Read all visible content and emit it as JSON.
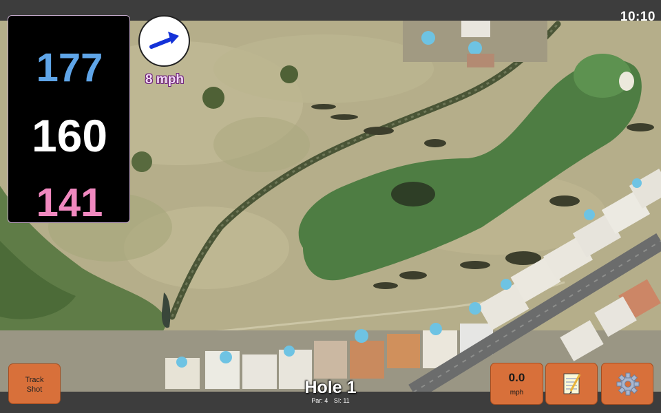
{
  "status": {
    "clock": "10:10"
  },
  "distances": {
    "back": "177",
    "middle": "160",
    "front": "141"
  },
  "wind": {
    "speed": "8 mph",
    "direction_icon": "arrow-right-up-icon",
    "arrow_color": "#1432d8"
  },
  "buttons": {
    "track_shot": {
      "line1": "Track",
      "line2": "Shot"
    },
    "speed": {
      "value": "0.0",
      "unit": "mph"
    },
    "notes": {
      "icon": "notepad-icon"
    },
    "settings": {
      "icon": "gear-icon"
    }
  },
  "hole": {
    "title": "Hole 1",
    "par": "Par: 4",
    "si": "SI: 11"
  },
  "colors": {
    "accent_orange": "#d8703a",
    "back_distance": "#5fa5e8",
    "front_distance": "#f088bf",
    "fairway": "#4e7d43",
    "rough": "#b6b08c"
  }
}
